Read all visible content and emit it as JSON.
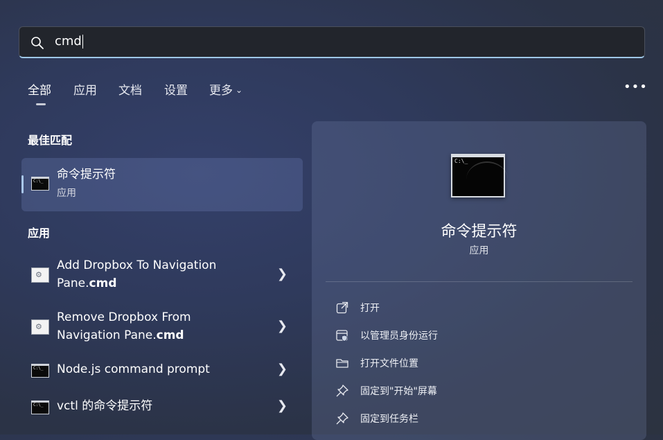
{
  "search": {
    "value": "cmd"
  },
  "tabs": [
    {
      "label": "全部"
    },
    {
      "label": "应用"
    },
    {
      "label": "文档"
    },
    {
      "label": "设置"
    },
    {
      "label": "更多"
    }
  ],
  "more_options": "•••",
  "best_match": {
    "section_title": "最佳匹配",
    "title": "命令提示符",
    "subtitle": "应用"
  },
  "apps": {
    "section_title": "应用",
    "items": [
      {
        "line1": "Add Dropbox To Navigation",
        "line2_prefix": "Pane.",
        "line2_bold": "cmd"
      },
      {
        "line1": "Remove Dropbox From",
        "line2_prefix": "Navigation Pane.",
        "line2_bold": "cmd"
      },
      {
        "title": "Node.js command prompt"
      },
      {
        "title": "vctl 的命令提示符"
      }
    ]
  },
  "detail": {
    "title": "命令提示符",
    "subtitle": "应用",
    "actions": [
      {
        "label": "打开",
        "icon": "open-external-icon"
      },
      {
        "label": "以管理员身份运行",
        "icon": "run-as-admin-icon"
      },
      {
        "label": "打开文件位置",
        "icon": "folder-icon"
      },
      {
        "label": "固定到\"开始\"屏幕",
        "icon": "pin-icon"
      },
      {
        "label": "固定到任务栏",
        "icon": "pin-icon"
      }
    ]
  },
  "icons": {
    "cmd_prompt_glyph": "C:\\_"
  }
}
